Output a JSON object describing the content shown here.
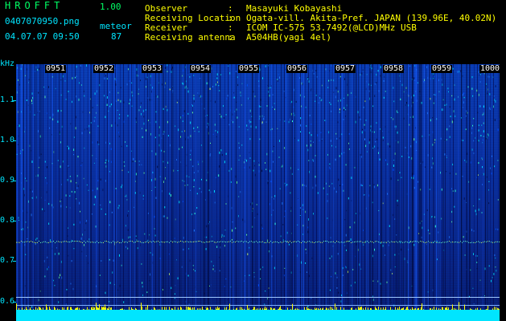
{
  "header": {
    "app_title": "HROFFT",
    "app_version": "1.00",
    "file_name": "0407070950.png",
    "mode": "meteor",
    "date_time": "04.07.07 09:50",
    "count": "87"
  },
  "station": {
    "observer_label": "Observer",
    "observer_value": "Masayuki Kobayashi",
    "location_label": "Receiving Location",
    "location_value": "Ogata-vill. Akita-Pref. JAPAN (139.96E, 40.02N)",
    "receiver_label": "Receiver",
    "receiver_value": "ICOM IC-575 53.7492(@LCD)MHz USB",
    "antenna_label": "Receiving antenna",
    "antenna_value": "A504HB(yagi 4el)",
    "separator": ":"
  },
  "spectrogram": {
    "y_unit": "kHz",
    "y_ticks": [
      "1.1",
      "1.0",
      "0.9",
      "0.8",
      "0.7",
      "0.6"
    ],
    "time_labels": [
      "0951",
      "0952",
      "0953",
      "0954",
      "0955",
      "0956",
      "0957",
      "0958",
      "0959",
      "1000"
    ],
    "colors": {
      "background": "#000000",
      "header_green": "#00ff66",
      "header_cyan": "#00e5ff",
      "meta_yellow": "#ffff00",
      "noise_blue": "#0a3fb5",
      "signal_cyan": "#00e5ff",
      "spike_yellow": "#ffff00"
    }
  }
}
